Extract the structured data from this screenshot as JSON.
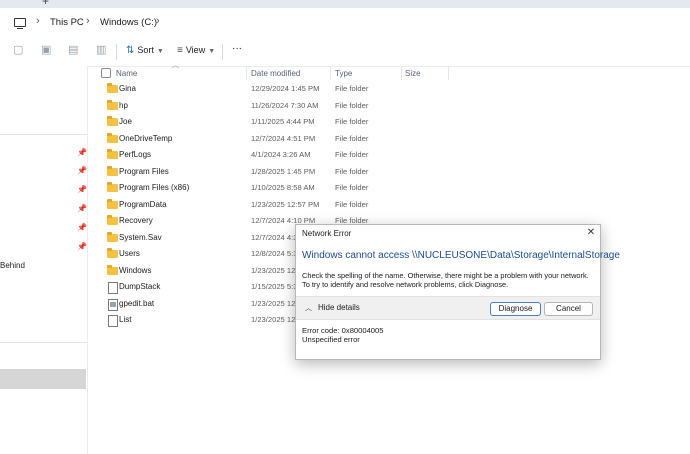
{
  "tabstrip": {
    "new_tab": "+"
  },
  "address": {
    "crumbs": [
      "This PC",
      "Windows (C:)"
    ],
    "separator": "›"
  },
  "toolbar": {
    "sort_label": "Sort",
    "view_label": "View",
    "more_label": "···"
  },
  "nav": {
    "partial_label": "Behind"
  },
  "columns": {
    "name": "Name",
    "date": "Date modified",
    "type": "Type",
    "size": "Size"
  },
  "files": [
    {
      "name": "Gina",
      "date": "12/29/2024 1:45 PM",
      "type": "File folder",
      "icon": "folder"
    },
    {
      "name": "hp",
      "date": "11/26/2024 7:30 AM",
      "type": "File folder",
      "icon": "folder"
    },
    {
      "name": "Joe",
      "date": "1/11/2025 4:44 PM",
      "type": "File folder",
      "icon": "folder"
    },
    {
      "name": "OneDriveTemp",
      "date": "12/7/2024 4:51 PM",
      "type": "File folder",
      "icon": "folder"
    },
    {
      "name": "PerfLogs",
      "date": "4/1/2024 3:26 AM",
      "type": "File folder",
      "icon": "folder"
    },
    {
      "name": "Program Files",
      "date": "1/28/2025 1:45 PM",
      "type": "File folder",
      "icon": "folder"
    },
    {
      "name": "Program Files (x86)",
      "date": "1/10/2025 8:58 AM",
      "type": "File folder",
      "icon": "folder"
    },
    {
      "name": "ProgramData",
      "date": "1/23/2025 12:57 PM",
      "type": "File folder",
      "icon": "folder"
    },
    {
      "name": "Recovery",
      "date": "12/7/2024 4:10 PM",
      "type": "File folder",
      "icon": "folder"
    },
    {
      "name": "System.Sav",
      "date": "12/7/2024 4:32",
      "type": "",
      "icon": "folder"
    },
    {
      "name": "Users",
      "date": "12/8/2024 5:32",
      "type": "",
      "icon": "folder"
    },
    {
      "name": "Windows",
      "date": "1/23/2025 12:4",
      "type": "",
      "icon": "folder"
    },
    {
      "name": "DumpStack",
      "date": "1/15/2025 5:31",
      "type": "",
      "icon": "file"
    },
    {
      "name": "gpedit.bat",
      "date": "1/23/2025 12:3",
      "type": "",
      "icon": "bat"
    },
    {
      "name": "List",
      "date": "1/23/2025 12:3",
      "type": "",
      "icon": "file"
    }
  ],
  "dialog": {
    "title": "Network Error",
    "close": "✕",
    "heading": "Windows cannot access \\\\NUCLEUSONE\\Data\\Storage\\InternalStorage",
    "message": "Check the spelling of the name. Otherwise, there might be a problem with your network. To try to identify and resolve network problems, click Diagnose.",
    "hide_details": "Hide details",
    "diagnose": "Diagnose",
    "cancel": "Cancel",
    "error_code": "Error code: 0x80004005",
    "error_desc": "Unspecified error"
  },
  "colors": {
    "accent": "#1a4d93",
    "folder": "#f6c143",
    "selection": "#d6d6d6"
  }
}
